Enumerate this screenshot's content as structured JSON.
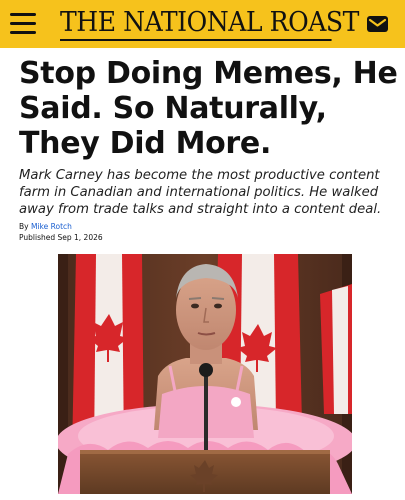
{
  "header": {
    "masthead": "THE NATIONAL ROAST",
    "menu_icon": "hamburger-menu-icon",
    "mail_icon": "envelope-icon",
    "background_color": "#f6c21c"
  },
  "article": {
    "headline": "Stop Doing Memes, He Said. So Naturally, They Did More.",
    "dek": "Mark Carney has become the most productive content farm in Canadian and international politics. He walked away from trade talks and straight into a content deal.",
    "byline_prefix": "By",
    "author": "Mike Rotch",
    "published": "Published Sep 1, 2026",
    "link_color": "#1a5fd0"
  }
}
